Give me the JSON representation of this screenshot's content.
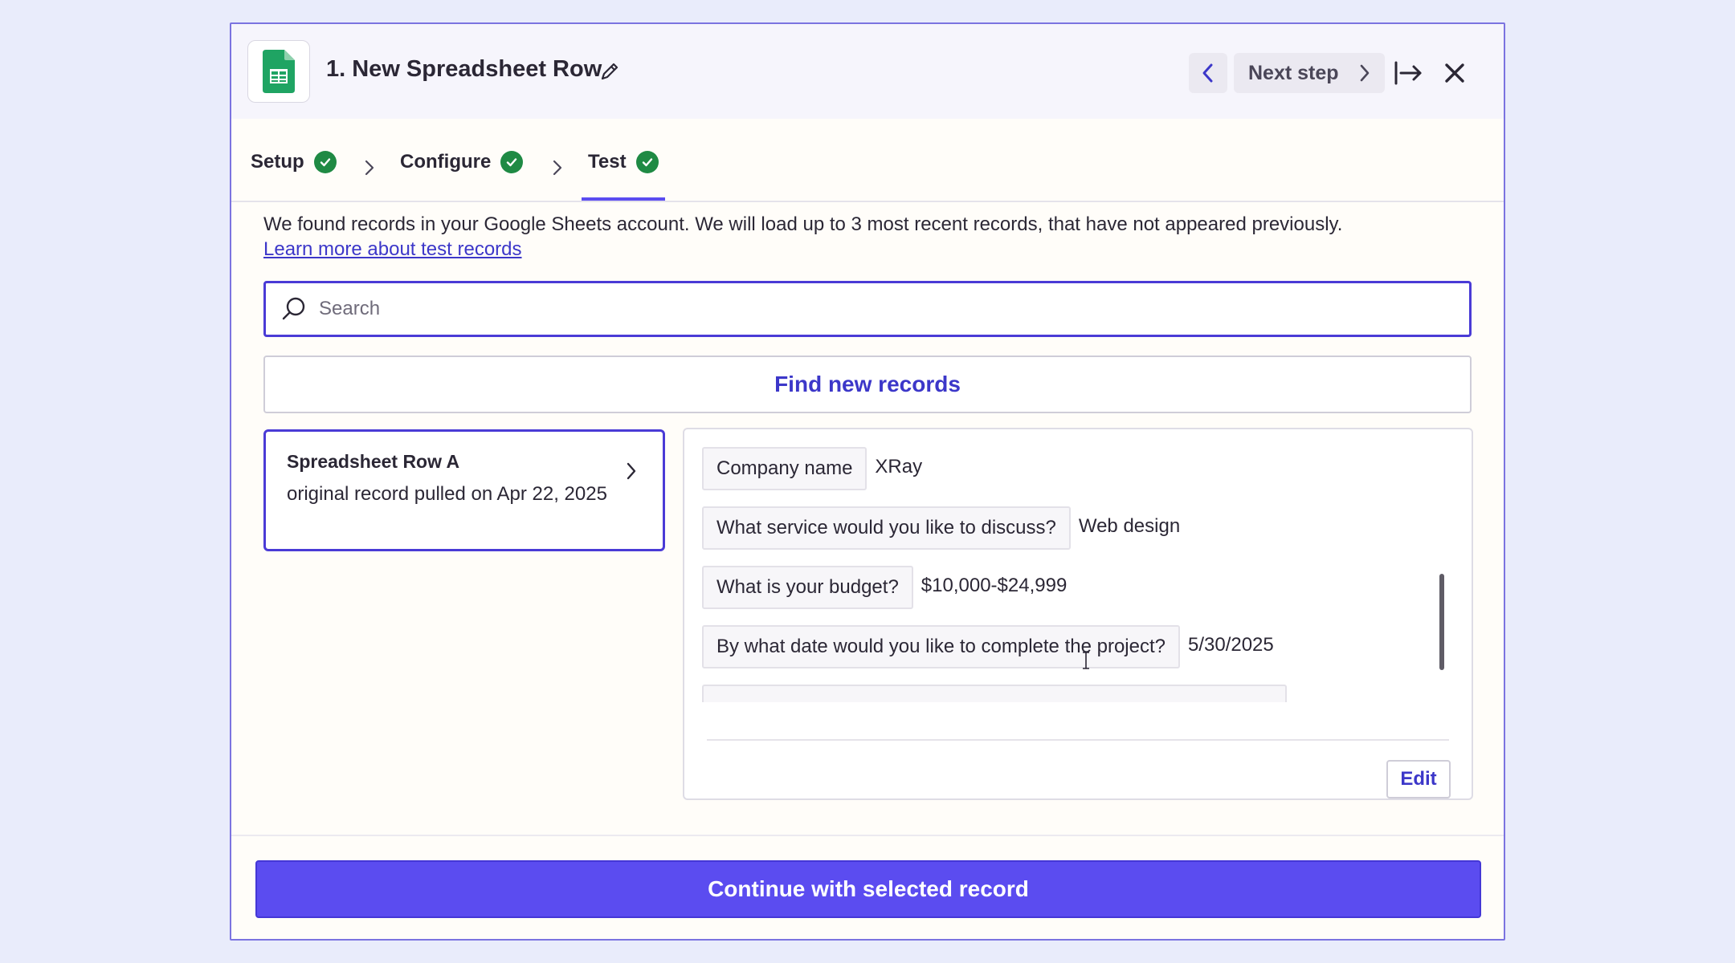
{
  "header": {
    "app_icon": "google-sheets-icon",
    "title": "1. New Spreadsheet Row",
    "prev_icon": "chevron-left-icon",
    "next_label": "Next step",
    "expand_icon": "arrow-to-right-icon",
    "close_icon": "close-icon"
  },
  "tabs": [
    {
      "label": "Setup",
      "status": "complete"
    },
    {
      "label": "Configure",
      "status": "complete"
    },
    {
      "label": "Test",
      "status": "complete",
      "active": true
    }
  ],
  "main": {
    "description": "We found records in your Google Sheets account. We will load up to 3 most recent records, that have not appeared previously.",
    "learn_more": "Learn more about test records",
    "search_placeholder": "Search",
    "find_button": "Find new records"
  },
  "record": {
    "title": "Spreadsheet Row A",
    "subtitle": "original record pulled on Apr 22, 2025"
  },
  "fields": [
    {
      "key": "Company name",
      "value": "XRay"
    },
    {
      "key": "What service would you like to discuss?",
      "value": "Web design"
    },
    {
      "key": "What is your budget?",
      "value": "$10,000-$24,999"
    },
    {
      "key": "By what date would you like to complete the project?",
      "value": "5/30/2025"
    }
  ],
  "edit_button": "Edit",
  "continue_button": "Continue with selected record",
  "colors": {
    "accent": "#5b4cf0",
    "link": "#3c37c9",
    "success": "#1f8a44",
    "sheets_green": "#1fa463"
  }
}
